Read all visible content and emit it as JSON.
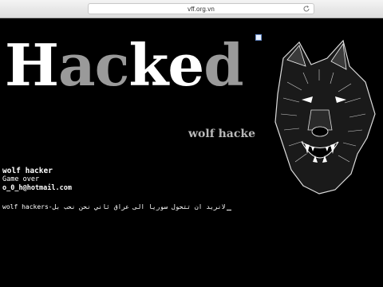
{
  "browser": {
    "url": "vff.org.vn"
  },
  "page": {
    "headline": {
      "h": "H",
      "ac": "ac",
      "k": "k",
      "e": "e",
      "d": "d"
    },
    "subtitle": "wolf hacker",
    "info": {
      "name": "wolf hacker",
      "status": "Game over",
      "email": "o_0_h@hotmail.com"
    },
    "message": "wolf hackers-لانريد ان تتحول سوريا الى عراق ثاني نحن نحب بل",
    "image": {
      "subject": "snarling wolf",
      "icon": "broken-image-icon"
    }
  },
  "colors": {
    "background": "#000000",
    "headline_white": "#ffffff",
    "headline_gray": "#9a9a9a",
    "subtitle": "#b9b9b9"
  }
}
